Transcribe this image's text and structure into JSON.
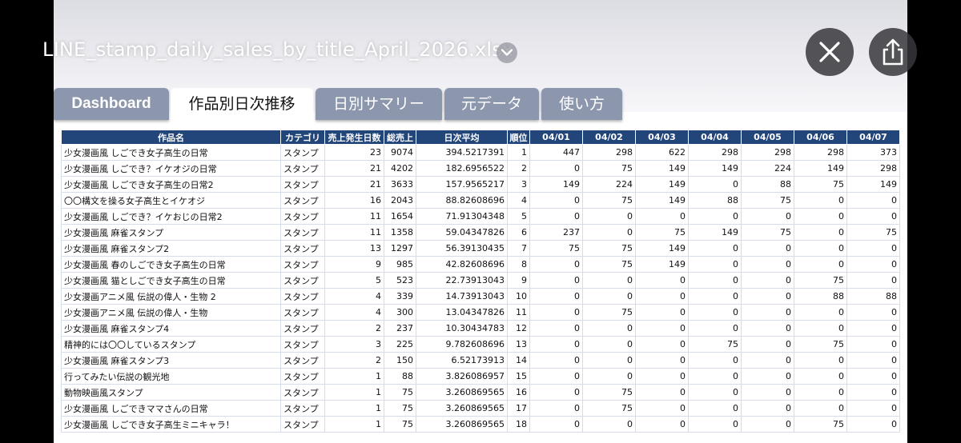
{
  "file": {
    "title": "LINE_stamp_daily_sales_by_title_April_2026.xlsx"
  },
  "toolbar": {
    "close_icon": "close-icon",
    "share_icon": "share-icon",
    "dropdown_icon": "chevron-down-icon"
  },
  "tabs": [
    {
      "label": "Dashboard"
    },
    {
      "label": "作品別日次推移"
    },
    {
      "label": "日別サマリー"
    },
    {
      "label": "元データ"
    },
    {
      "label": "使い方"
    }
  ],
  "table": {
    "headers": [
      "作品名",
      "カテゴリ",
      "売上発生日数",
      "総売上",
      "日次平均",
      "順位",
      "04/01",
      "04/02",
      "04/03",
      "04/04",
      "04/05",
      "04/06",
      "04/07"
    ],
    "rows": [
      [
        "少女漫画風 しごでき女子高生の日常",
        "スタンプ",
        "23",
        "9074",
        "394.5217391",
        "1",
        "447",
        "298",
        "622",
        "298",
        "298",
        "298",
        "373"
      ],
      [
        "少女漫画風 しごでき？イケオジの日常",
        "スタンプ",
        "21",
        "4202",
        "182.6956522",
        "2",
        "0",
        "75",
        "149",
        "149",
        "224",
        "149",
        "298"
      ],
      [
        "少女漫画風 しごでき女子高生の日常2",
        "スタンプ",
        "21",
        "3633",
        "157.9565217",
        "3",
        "149",
        "224",
        "149",
        "0",
        "88",
        "75",
        "149"
      ],
      [
        "〇〇構文を操る女子高生とイケオジ",
        "スタンプ",
        "16",
        "2043",
        "88.82608696",
        "4",
        "0",
        "75",
        "149",
        "88",
        "75",
        "0",
        "0"
      ],
      [
        "少女漫画風 しごでき？イケおじの日常2",
        "スタンプ",
        "11",
        "1654",
        "71.91304348",
        "5",
        "0",
        "0",
        "0",
        "0",
        "0",
        "0",
        "0"
      ],
      [
        "少女漫画風 麻雀スタンプ",
        "スタンプ",
        "11",
        "1358",
        "59.04347826",
        "6",
        "237",
        "0",
        "75",
        "149",
        "75",
        "0",
        "75"
      ],
      [
        "少女漫画風 麻雀スタンプ2",
        "スタンプ",
        "13",
        "1297",
        "56.39130435",
        "7",
        "75",
        "75",
        "149",
        "0",
        "0",
        "0",
        "0"
      ],
      [
        "少女漫画風 春のしごでき女子高生の日常",
        "スタンプ",
        "9",
        "985",
        "42.82608696",
        "8",
        "0",
        "75",
        "149",
        "0",
        "0",
        "0",
        "0"
      ],
      [
        "少女漫画風 猫としごでき女子高生の日常",
        "スタンプ",
        "5",
        "523",
        "22.73913043",
        "9",
        "0",
        "0",
        "0",
        "0",
        "0",
        "75",
        "0"
      ],
      [
        "少女漫画アニメ風 伝説の偉人・生物 2",
        "スタンプ",
        "4",
        "339",
        "14.73913043",
        "10",
        "0",
        "0",
        "0",
        "0",
        "0",
        "88",
        "88"
      ],
      [
        "少女漫画アニメ風 伝説の偉人・生物",
        "スタンプ",
        "4",
        "300",
        "13.04347826",
        "11",
        "0",
        "75",
        "0",
        "0",
        "0",
        "0",
        "0"
      ],
      [
        "少女漫画風 麻雀スタンプ4",
        "スタンプ",
        "2",
        "237",
        "10.30434783",
        "12",
        "0",
        "0",
        "0",
        "0",
        "0",
        "0",
        "0"
      ],
      [
        "精神的には〇〇しているスタンプ",
        "スタンプ",
        "3",
        "225",
        "9.782608696",
        "13",
        "0",
        "0",
        "0",
        "75",
        "0",
        "75",
        "0"
      ],
      [
        "少女漫画風 麻雀スタンプ3",
        "スタンプ",
        "2",
        "150",
        "6.52173913",
        "14",
        "0",
        "0",
        "0",
        "0",
        "0",
        "0",
        "0"
      ],
      [
        "行ってみたい伝説の観光地",
        "スタンプ",
        "1",
        "88",
        "3.826086957",
        "15",
        "0",
        "0",
        "0",
        "0",
        "0",
        "0",
        "0"
      ],
      [
        "動物映画風スタンプ",
        "スタンプ",
        "1",
        "75",
        "3.260869565",
        "16",
        "0",
        "75",
        "0",
        "0",
        "0",
        "0",
        "0"
      ],
      [
        "少女漫画風 しごできママさんの日常",
        "スタンプ",
        "1",
        "75",
        "3.260869565",
        "17",
        "0",
        "75",
        "0",
        "0",
        "0",
        "0",
        "0"
      ],
      [
        "少女漫画風 しごでき女子高生ミニキャラ！",
        "スタンプ",
        "1",
        "75",
        "3.260869565",
        "18",
        "0",
        "0",
        "0",
        "0",
        "0",
        "75",
        "0"
      ]
    ]
  }
}
